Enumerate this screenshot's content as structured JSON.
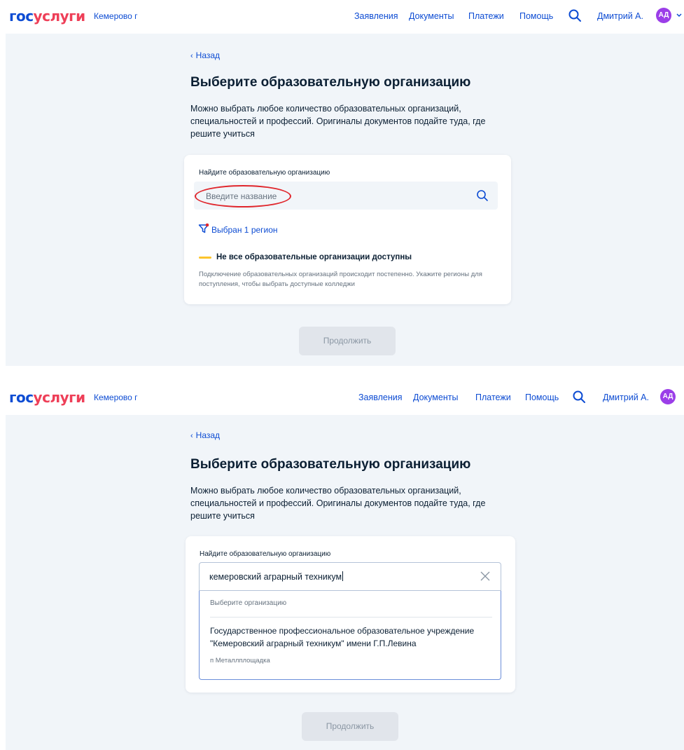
{
  "header": {
    "logo_part1": "гос",
    "logo_part2": "услуги",
    "city": "Кемерово г",
    "nav": [
      "Заявления",
      "Документы",
      "Платежи",
      "Помощь"
    ],
    "user_name": "Дмитрий А.",
    "avatar_initials": "АД"
  },
  "page": {
    "back": "Назад",
    "title": "Выберите образовательную организацию",
    "description": "Можно выбрать любое количество образовательных организаций, специальностей и профессий. Оригиналы документов подайте туда, где решите учиться"
  },
  "search": {
    "label": "Найдите образовательную организацию",
    "placeholder": "Введите название",
    "typed_value": "кемеровский аграрный техникум"
  },
  "region_filter": "Выбран 1 регион",
  "warning": {
    "title": "Не все образовательные организации доступны",
    "text": "Подключение образовательных организаций происходит постепенно. Укажите регионы для поступления, чтобы выбрать доступные колледжи"
  },
  "dropdown": {
    "header": "Выберите организацию",
    "items": [
      {
        "name": "Государственное профессиональное образовательное учреждение \"Кемеровский аграрный техникум\" имени Г.П.Левина",
        "location": "п Металлплощадка"
      }
    ]
  },
  "continue_button": "Продолжить",
  "colors": {
    "accent": "#0d4cd3",
    "logo_red": "#ee3f58",
    "avatar": "#9b3ee8",
    "warning": "#fcc52c",
    "annotation": "#e0262c",
    "background": "#f1f5f9"
  }
}
